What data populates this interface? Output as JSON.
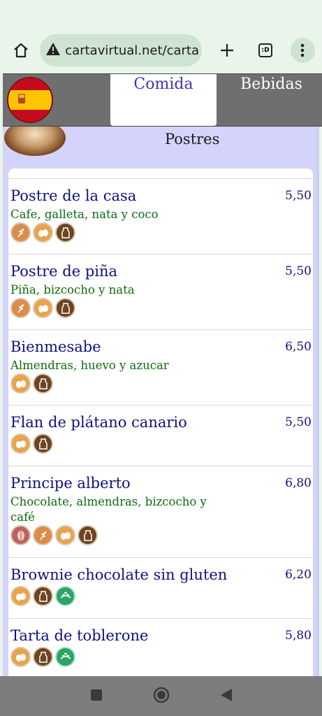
{
  "browser": {
    "url": "cartavirtual.net/carta",
    "tabs_count": ":D"
  },
  "header": {
    "tabs": [
      {
        "label": "Comida"
      },
      {
        "label": "Bebidas"
      }
    ]
  },
  "category": {
    "title": "Postres"
  },
  "items": [
    {
      "name": "Postre de la casa",
      "price": "5,50",
      "desc": "Cafe, galleta, nata y coco",
      "allergens": [
        "gluten-icon",
        "egg-icon",
        "milk-icon"
      ]
    },
    {
      "name": "Postre de piña",
      "price": "5,50",
      "desc": "Piña, bizcocho y nata",
      "allergens": [
        "gluten-icon",
        "egg-icon",
        "milk-icon"
      ]
    },
    {
      "name": "Bienmesabe",
      "price": "6,50",
      "desc": "Almendras, huevo y azucar",
      "allergens": [
        "egg-icon",
        "milk-icon"
      ]
    },
    {
      "name": "Flan de plátano canario",
      "price": "5,50",
      "desc": "",
      "allergens": [
        "egg-icon",
        "milk-icon"
      ]
    },
    {
      "name": "Principe alberto",
      "price": "6,80",
      "desc": "Chocolate, almendras, bizcocho y café",
      "allergens": [
        "nuts-icon",
        "gluten-icon",
        "egg-icon",
        "milk-icon"
      ]
    },
    {
      "name": "Brownie chocolate sin gluten",
      "price": "6,20",
      "desc": "",
      "allergens": [
        "egg-icon",
        "milk-icon",
        "gluten-free-icon"
      ]
    },
    {
      "name": "Tarta de toblerone",
      "price": "5,80",
      "desc": "",
      "allergens": [
        "egg-icon",
        "milk-icon",
        "gluten-free-icon"
      ]
    }
  ]
}
